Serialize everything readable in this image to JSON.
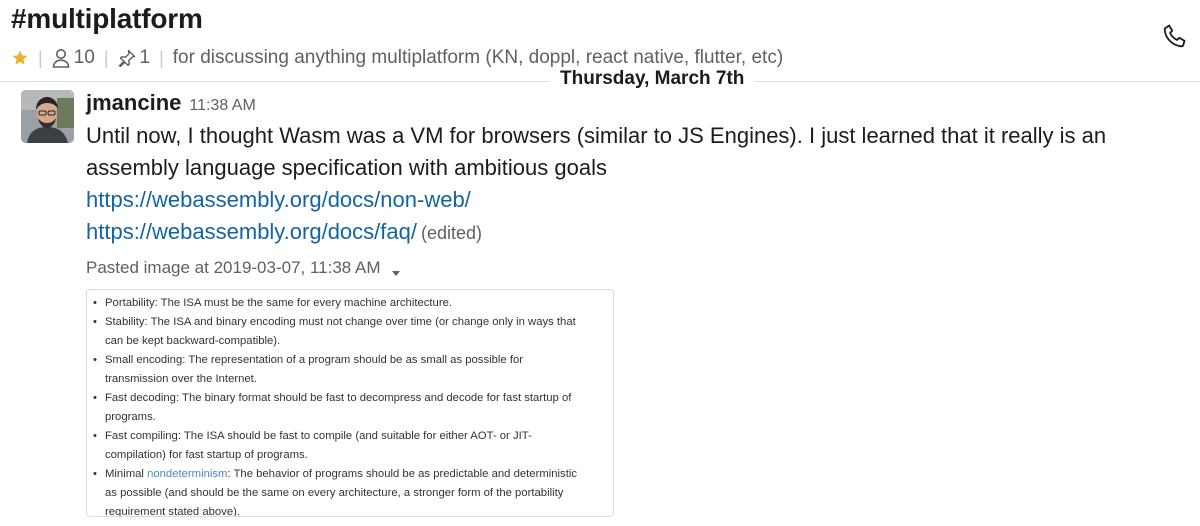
{
  "channel": {
    "name": "#multiplatform",
    "members_count": "10",
    "pins_count": "1",
    "topic": "for discussing anything multiplatform (KN, doppl, react native, flutter, etc)"
  },
  "colors": {
    "star": "#ecb22e",
    "link": "#1264a3",
    "muted": "#616061",
    "highlight": "#4a86c5"
  },
  "icons": {
    "star": "star-icon",
    "members": "person-icon",
    "pins": "pin-icon",
    "call": "phone-icon",
    "menu": "chevron-down-icon"
  },
  "date_divider": "Thursday, March 7th",
  "message": {
    "author": "jmancine",
    "time": "11:38 AM",
    "text": "Until now, I thought Wasm was a VM for browsers (similar to JS Engines). I just learned that it really is an assembly language specification with ambitious goals",
    "links": [
      "https://webassembly.org/docs/non-web/",
      "https://webassembly.org/docs/faq/"
    ],
    "edited_label": "(edited)",
    "attachment": {
      "title": "Pasted image at 2019-03-07, 11:38 AM",
      "bullets": [
        {
          "lines": [
            "Portability: The ISA must be the same for every machine architecture."
          ]
        },
        {
          "lines": [
            "Stability: The ISA and binary encoding must not change over time (or change only in ways that",
            "can be kept backward-compatible)."
          ]
        },
        {
          "lines": [
            "Small encoding: The representation of a program should be as small as possible for",
            "transmission over the Internet."
          ]
        },
        {
          "lines": [
            "Fast decoding: The binary format should be fast to decompress and decode for fast startup of",
            "programs."
          ]
        },
        {
          "lines": [
            "Fast compiling: The ISA should be fast to compile (and suitable for either AOT- or JIT-",
            "compilation) for fast startup of programs."
          ]
        },
        {
          "prefix": "Minimal ",
          "link": "nondeterminism",
          "suffix": ": The behavior of programs should be as predictable and deterministic",
          "lines": [
            "as possible (and should be the same on every architecture, a stronger form of the portability",
            "requirement stated above)."
          ]
        }
      ]
    }
  }
}
